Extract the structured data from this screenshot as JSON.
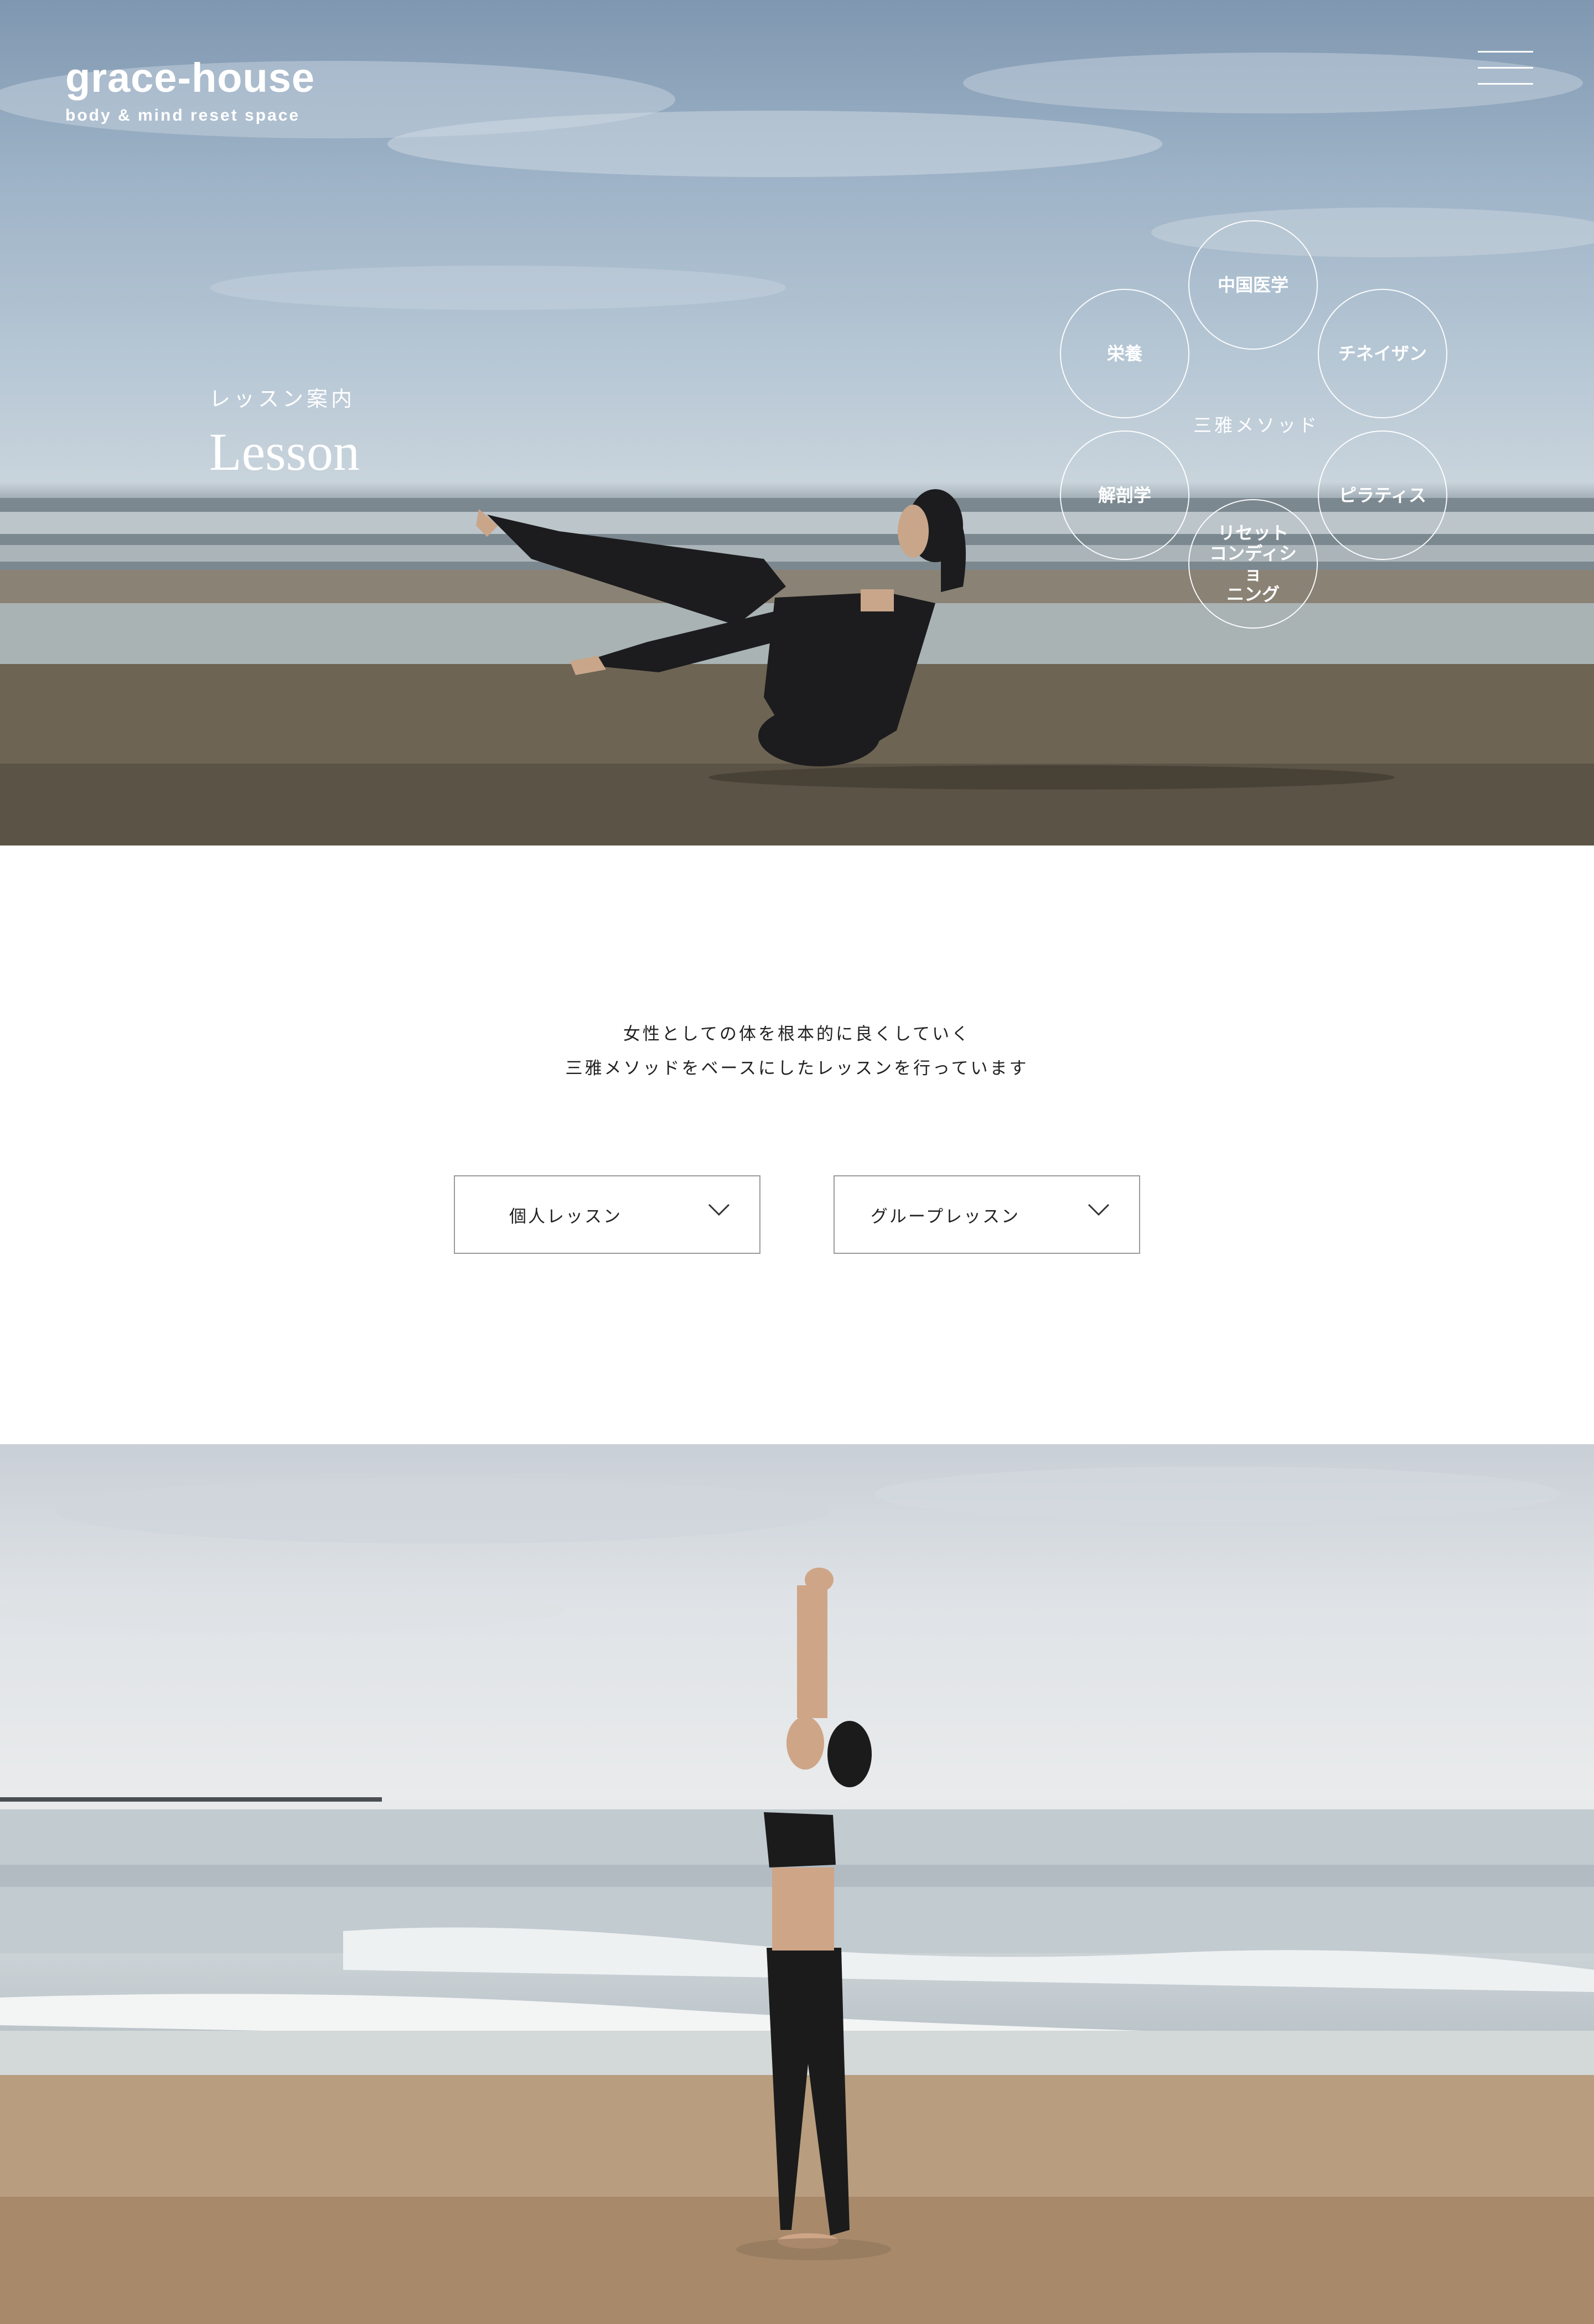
{
  "header": {
    "logo_name": "grace-house",
    "logo_tagline": "body & mind reset space",
    "menu_icon": "hamburger-menu-icon"
  },
  "hero": {
    "subtitle": "レッスン案内",
    "title": "Lesson",
    "method": {
      "center_label": "三雅メソッド",
      "items": [
        {
          "label": "中国医学"
        },
        {
          "label": "チネイザン"
        },
        {
          "label": "ピラティス"
        },
        {
          "label": "リセット\nコンディショ\nニング"
        },
        {
          "label": "解剖学"
        },
        {
          "label": "栄養"
        }
      ]
    }
  },
  "intro": {
    "line1": "女性としての体を根本的に良くしていく",
    "line2": "三雅メソッドをベースにしたレッスンを行っています"
  },
  "lessons": [
    {
      "label": "個人レッスン",
      "icon": "chevron-down-icon"
    },
    {
      "label": "グループレッスン",
      "icon": "chevron-down-icon"
    }
  ],
  "colors": {
    "text": "#222222",
    "button_border": "#9a9a9a",
    "overlay_text": "#ffffff"
  }
}
